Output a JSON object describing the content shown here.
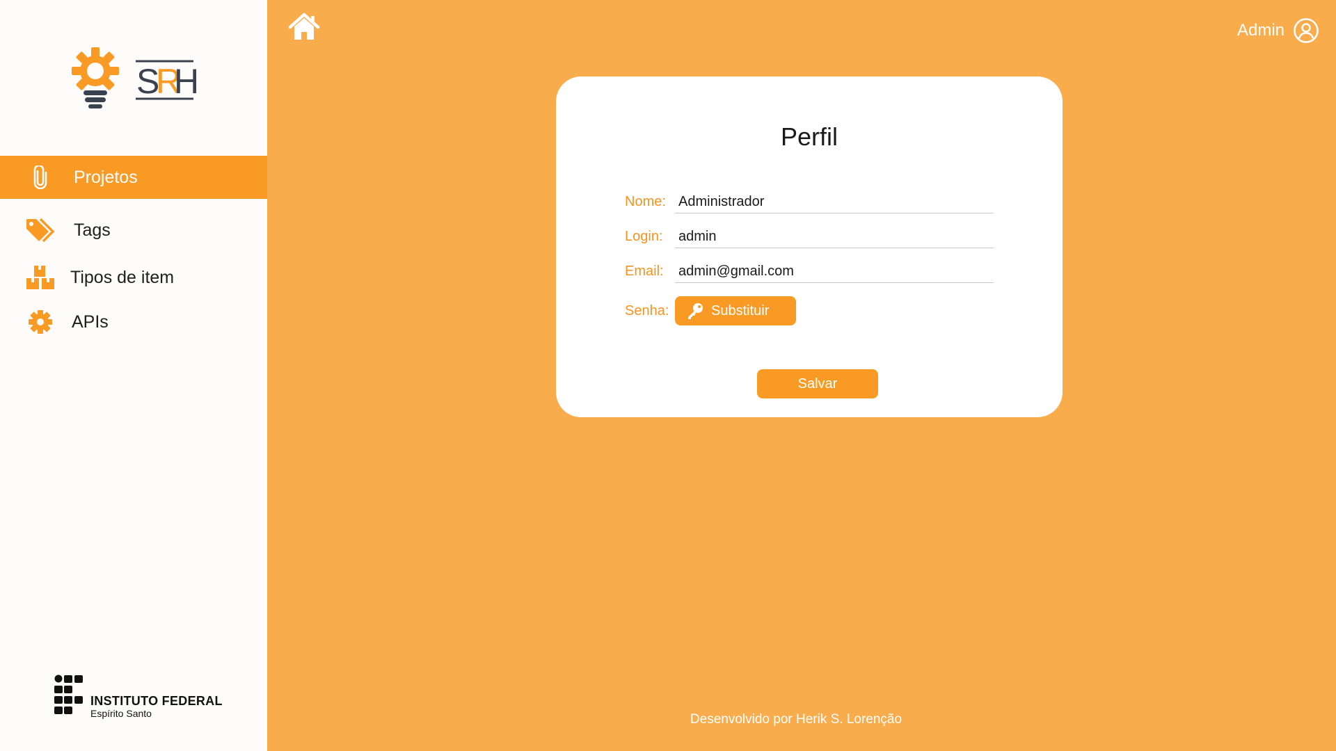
{
  "app": {
    "logo_text_s": "S",
    "logo_text_r": "R",
    "logo_text_h": "H",
    "logo_icon": "lightbulb-gear-icon"
  },
  "sidebar": {
    "items": [
      {
        "label": "Projetos",
        "icon": "paperclip-icon",
        "active": true
      },
      {
        "label": "Tags",
        "icon": "tags-icon",
        "active": false
      },
      {
        "label": "Tipos de item",
        "icon": "boxes-icon",
        "active": false
      },
      {
        "label": "APIs",
        "icon": "gear-icon",
        "active": false
      }
    ],
    "institution_title": "INSTITUTO FEDERAL",
    "institution_sub": "Espírito Santo"
  },
  "header": {
    "home_icon": "home-icon",
    "user_name": "Admin",
    "user_icon": "user-circle-icon"
  },
  "profile": {
    "title": "Perfil",
    "fields": {
      "name_label": "Nome:",
      "name_value": "Administrador",
      "login_label": "Login:",
      "login_value": "admin",
      "email_label": "Email:",
      "email_value": "admin@gmail.com",
      "password_label": "Senha:"
    },
    "replace_button": "Substituir",
    "save_button": "Salvar"
  },
  "footer": {
    "text": "Desenvolvido por Herik S. Lorenção"
  },
  "colors": {
    "background": "#f9ac4b",
    "accent": "#f99a24",
    "label": "#f7931e",
    "logo_dark": "#3a4250",
    "sidebar": "#fefcfa"
  }
}
